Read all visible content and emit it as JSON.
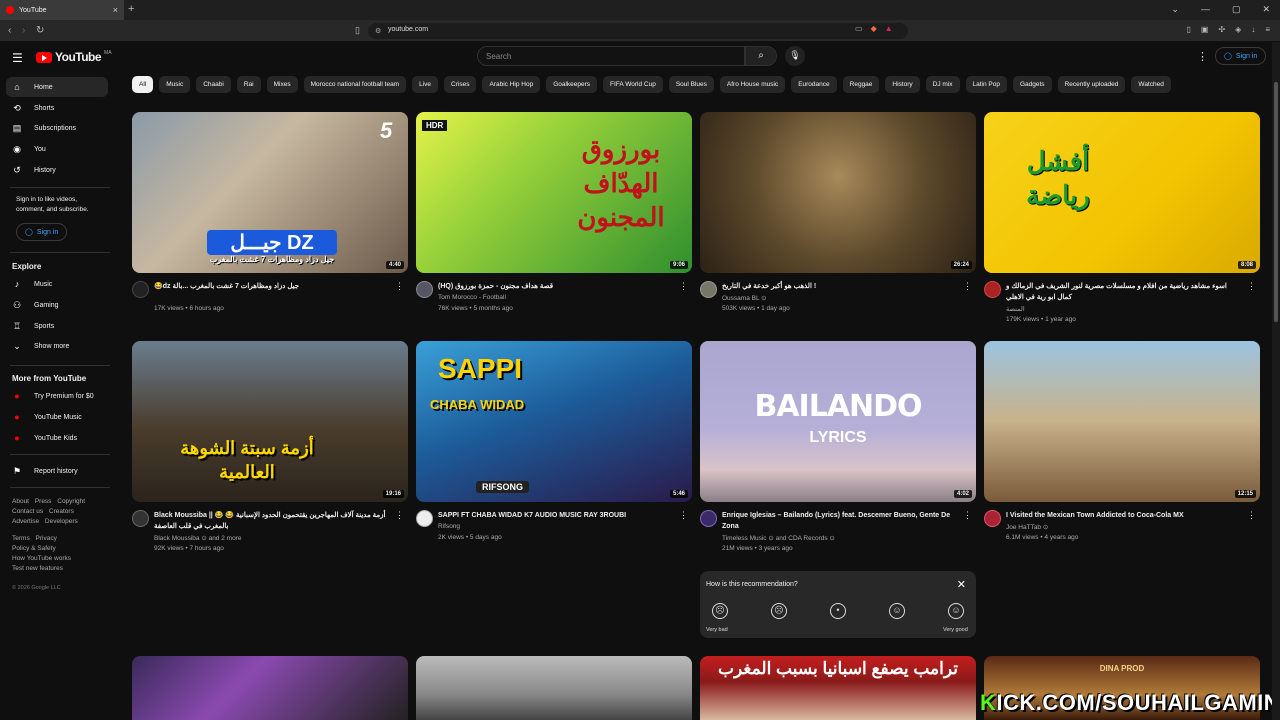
{
  "browser": {
    "tab_title": "YouTube",
    "tab_close": "×",
    "new_tab": "+",
    "url": "youtube.com",
    "window_controls": [
      "⌄",
      "—",
      "▢",
      "✕"
    ]
  },
  "header": {
    "logo_text": "YouTube",
    "logo_region": "MA",
    "search_placeholder": "Search",
    "signin_label": "Sign in"
  },
  "sidebar": {
    "main_items": [
      {
        "label": "Home",
        "icon": "home-icon",
        "glyph": "⌂"
      },
      {
        "label": "Shorts",
        "icon": "shorts-icon",
        "glyph": "⟲"
      },
      {
        "label": "Subscriptions",
        "icon": "subscriptions-icon",
        "glyph": "▤"
      },
      {
        "label": "You",
        "icon": "user-icon",
        "glyph": "◉"
      },
      {
        "label": "History",
        "icon": "history-icon",
        "glyph": "↺"
      }
    ],
    "signin_note": "Sign in to like videos, comment, and subscribe.",
    "signin_label": "Sign in",
    "explore_heading": "Explore",
    "explore_items": [
      {
        "label": "Music",
        "icon": "music-icon",
        "glyph": "♪"
      },
      {
        "label": "Gaming",
        "icon": "gaming-icon",
        "glyph": "⚇"
      },
      {
        "label": "Sports",
        "icon": "trophy-icon",
        "glyph": "♖"
      },
      {
        "label": "Show more",
        "icon": "chevron-down-icon",
        "glyph": "⌄"
      }
    ],
    "more_heading": "More from YouTube",
    "more_items": [
      {
        "label": "Try Premium for $0",
        "icon": "youtube-premium-icon",
        "glyph": "●"
      },
      {
        "label": "YouTube Music",
        "icon": "youtube-music-icon",
        "glyph": "●"
      },
      {
        "label": "YouTube Kids",
        "icon": "youtube-kids-icon",
        "glyph": "●"
      }
    ],
    "report_history": "Report history",
    "footer_row1": [
      "About",
      "Press",
      "Copyright"
    ],
    "footer_row2": [
      "Contact us",
      "Creators"
    ],
    "footer_row3": [
      "Advertise",
      "Developers"
    ],
    "footer_row4": [
      "Terms",
      "Privacy"
    ],
    "footer_row5": [
      "Policy & Safety"
    ],
    "footer_row6": [
      "How YouTube works"
    ],
    "footer_row7": [
      "Test new features"
    ],
    "copyright": "© 2026 Google LLC"
  },
  "chips": [
    "All",
    "Music",
    "Chaabi",
    "Rai",
    "Mixes",
    "Morocco national football team",
    "Live",
    "Crises",
    "Arabic Hip Hop",
    "Goalkeepers",
    "FIFA World Cup",
    "Soul Blues",
    "Afro House music",
    "Eurodance",
    "Reggae",
    "History",
    "DJ mix",
    "Latin Pop",
    "Gadgets",
    "Recently uploaded",
    "Watched"
  ],
  "videos": [
    {
      "title": "😂dz جيل دزاد ومظاهرات 7 غشت بالمغرب ...بالة",
      "channel": "",
      "stats": "17K views • 6 hours ago",
      "duration": "4:40",
      "thumb_text": "جيـــل DZ",
      "thumb_sub": "جيل دزاد ومظاهرات 7 غشت بالمغرب",
      "badge": "5"
    },
    {
      "title": "(HQ) قصة هداف مجنون - حمزة بورزوق",
      "channel": "Tom Morocco - Football",
      "stats": "76K views • 5 months ago",
      "duration": "9:06",
      "thumb_text": "بورزوق الهدّاف المجنون",
      "badge": "HDR"
    },
    {
      "title": "الذهب هو أكبر خدعة في التاريخ !",
      "channel": "Oussama BL ⊙",
      "stats": "503K views • 1 day ago",
      "duration": "26:24"
    },
    {
      "title": "اسوء مشاهد رياضية من افلام و مسلسلات مصرية لنور الشريف في الزمالك و كمال ابو رية في الاهلي",
      "channel": "المنصة",
      "stats": "179K views • 1 year ago",
      "duration": "8:08",
      "thumb_text": "أفشل رياضة"
    },
    {
      "title": "Black Moussiba || 😂 😂 أزمة مدينة آلاف المهاجرين يقتحمون الحدود الإسبانية بالمغرب في قلب العاصفة",
      "channel": "Black Moussiba ⊙ and 2 more",
      "stats": "92K views • 7 hours ago",
      "duration": "19:16",
      "thumb_text": "أزمة سبتة الشوهة العالمية"
    },
    {
      "title": "SAPPI FT CHABA WIDAD K7 AUDIO MUSIC RAY 3ROUBI",
      "channel": "Rifsong",
      "stats": "2K views • 5 days ago",
      "duration": "5:46",
      "thumb_text": "SAPPI",
      "thumb_sub": "CHABA WIDAD",
      "thumb_sub2": "RIFSONG"
    },
    {
      "title": "Enrique Iglesias – Bailando (Lyrics) feat. Descemer Bueno, Gente De Zona",
      "channel": "Timeless Music ⊙ and CDA Records ⊙",
      "stats": "21M views • 3 years ago",
      "duration": "4:02",
      "thumb_text": "BAILANDO",
      "thumb_sub": "LYRICS"
    },
    {
      "title": "I Visited the Mexican Town Addicted to Coca-Cola MX",
      "channel": "Joe HaTTab ⊙",
      "stats": "6.1M views • 4 years ago",
      "duration": "12:15"
    }
  ],
  "bottom_row": [
    {
      "thumb_text": ""
    },
    {
      "thumb_text": ""
    },
    {
      "thumb_text": "ترامب يصفع اسبانيا بسبب المغرب"
    },
    {
      "thumb_text": "DINA PROD"
    }
  ],
  "feedback": {
    "question": "How is this recommendation?",
    "close": "✕",
    "faces": [
      "☹",
      "☹",
      "•",
      "☺",
      "☺"
    ],
    "label_left": "Very bad",
    "label_right": "Very good"
  },
  "watermark": {
    "k": "K",
    "rest": "ICK.COM/SOUHAILGAMING"
  },
  "colors": {
    "accent": "#3ea6ff",
    "brand": "#ff0000",
    "bg": "#0f0f0f",
    "chip": "#272727"
  }
}
